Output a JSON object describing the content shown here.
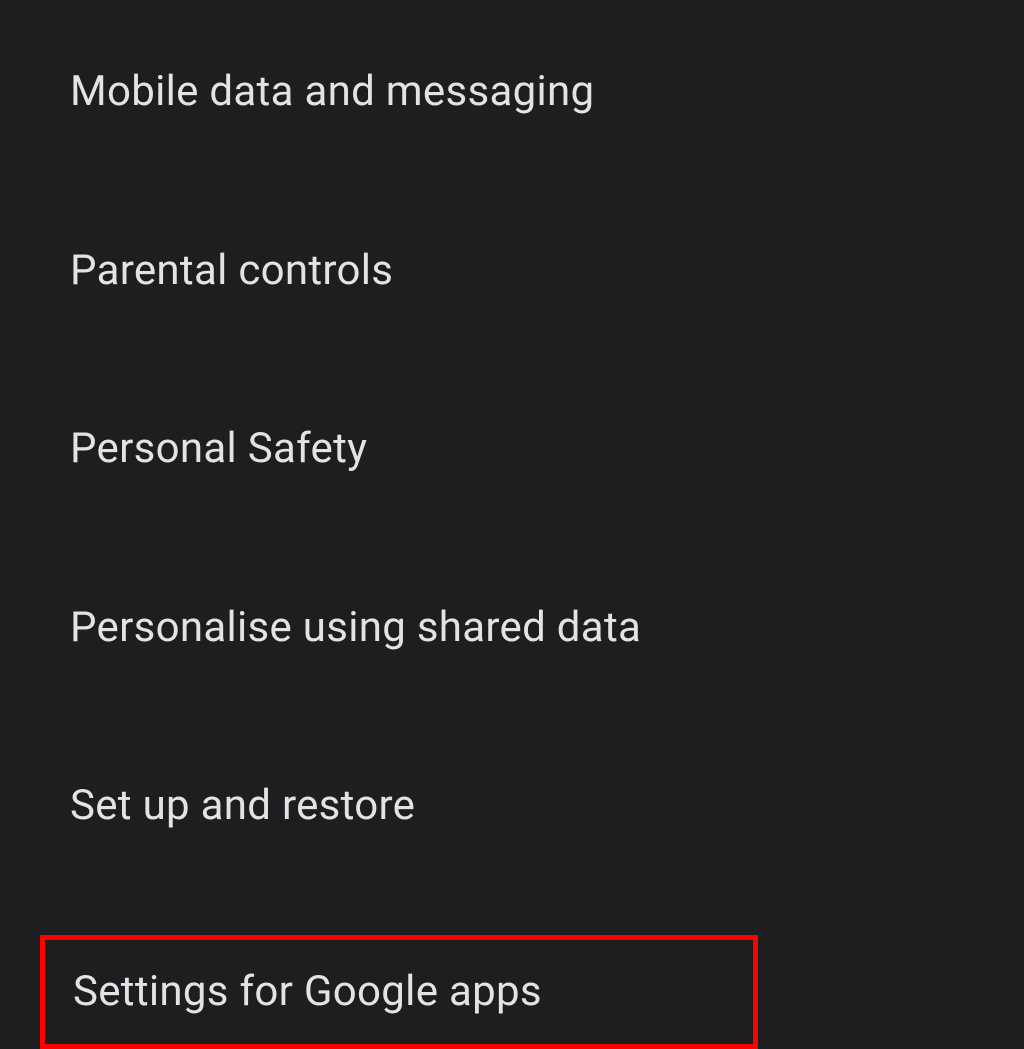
{
  "settings": {
    "items": [
      {
        "label": "Mobile data and messaging"
      },
      {
        "label": "Parental controls"
      },
      {
        "label": "Personal Safety"
      },
      {
        "label": "Personalise using shared data"
      },
      {
        "label": "Set up and restore"
      },
      {
        "label": "Settings for Google apps"
      }
    ],
    "highlight_color": "#ff0000"
  }
}
